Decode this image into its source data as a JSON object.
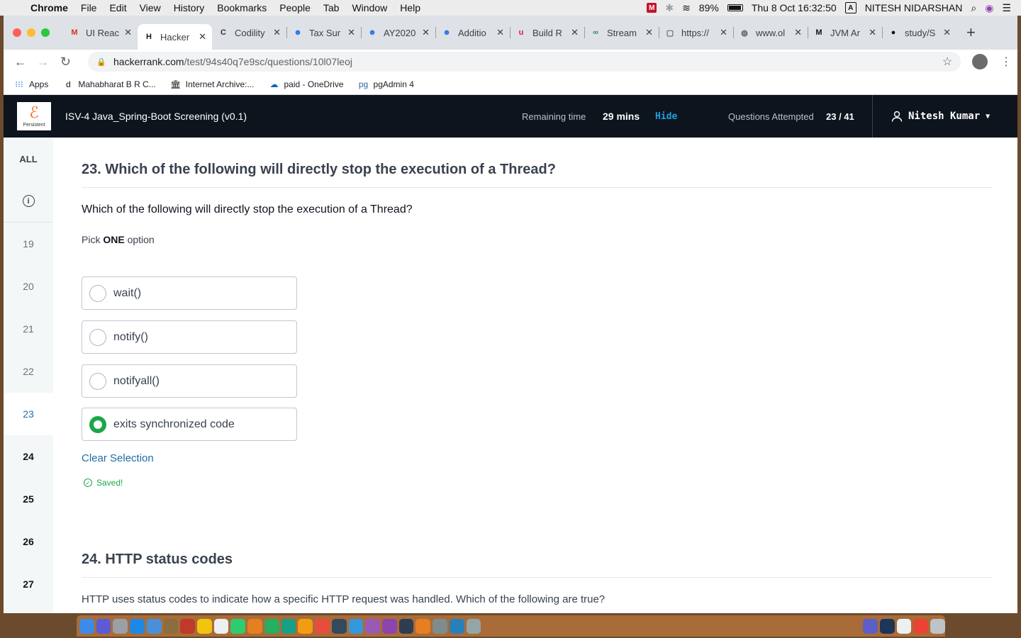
{
  "menubar": {
    "app": "Chrome",
    "items": [
      "File",
      "Edit",
      "View",
      "History",
      "Bookmarks",
      "People",
      "Tab",
      "Window",
      "Help"
    ],
    "battery": "89%",
    "datetime": "Thu 8 Oct  16:32:50",
    "input_source": "A",
    "user": "NITESH NIDARSHAN"
  },
  "tabs": [
    {
      "title": "UI Reac",
      "icon": "gmail-icon",
      "color": "#d93025",
      "glyph": "M",
      "active": false
    },
    {
      "title": "Hacker",
      "icon": "hackerrank-icon",
      "color": "#0e141e",
      "glyph": "H",
      "active": true
    },
    {
      "title": "Codility",
      "icon": "codility-icon",
      "color": "#333333",
      "glyph": "C",
      "active": false
    },
    {
      "title": "Tax Sur",
      "icon": "person-icon",
      "color": "#1a73e8",
      "glyph": "☻",
      "active": false
    },
    {
      "title": "AY2020",
      "icon": "person-icon",
      "color": "#1a73e8",
      "glyph": "☻",
      "active": false
    },
    {
      "title": "Additio",
      "icon": "person-icon",
      "color": "#1a73e8",
      "glyph": "☻",
      "active": false
    },
    {
      "title": "Build R",
      "icon": "build-icon",
      "color": "#e11d48",
      "glyph": "u",
      "active": false
    },
    {
      "title": "Stream",
      "icon": "stream-icon",
      "color": "#2e8b57",
      "glyph": "∞",
      "active": false
    },
    {
      "title": "https://",
      "icon": "page-icon",
      "color": "#5f6368",
      "glyph": "▢",
      "active": false
    },
    {
      "title": "www.ol",
      "icon": "globe-icon",
      "color": "#5f6368",
      "glyph": "◍",
      "active": false
    },
    {
      "title": "JVM Ar",
      "icon": "medium-icon",
      "color": "#111111",
      "glyph": "M",
      "active": false
    },
    {
      "title": "study/S",
      "icon": "github-icon",
      "color": "#111111",
      "glyph": "●",
      "active": false
    }
  ],
  "address": {
    "host": "hackerrank.com",
    "path": "/test/94s40q7e9sc/questions/10l07leoj"
  },
  "bookmarks": [
    {
      "label": "Apps",
      "icon": "apps-grid-icon",
      "glyph": "⁝⁝⁝",
      "color": "#1a73e8"
    },
    {
      "label": "Mahabharat B R C...",
      "icon": "d-logo-icon",
      "glyph": "d",
      "color": "#111111"
    },
    {
      "label": "Internet Archive:...",
      "icon": "archive-icon",
      "glyph": "🏛",
      "color": "#111111"
    },
    {
      "label": "paid - OneDrive",
      "icon": "onedrive-icon",
      "glyph": "☁",
      "color": "#0a66c2"
    },
    {
      "label": "pgAdmin 4",
      "icon": "pgadmin-icon",
      "glyph": "pg",
      "color": "#336791"
    }
  ],
  "header": {
    "test_name": "ISV-4 Java_Spring-Boot Screening (v0.1)",
    "logo_text": "Persistent",
    "remaining_label": "Remaining time",
    "remaining_value": "29 mins",
    "hide_label": "Hide",
    "attempted_label": "Questions Attempted",
    "attempted_value": "23 / 41",
    "user_name": "Nitesh Kumar"
  },
  "sidenav": {
    "all_label": "ALL",
    "questions": [
      {
        "num": "19",
        "state": "done"
      },
      {
        "num": "20",
        "state": "done"
      },
      {
        "num": "21",
        "state": "done"
      },
      {
        "num": "22",
        "state": "done"
      },
      {
        "num": "23",
        "state": "current"
      },
      {
        "num": "24",
        "state": "todo"
      },
      {
        "num": "25",
        "state": "todo"
      },
      {
        "num": "26",
        "state": "todo"
      },
      {
        "num": "27",
        "state": "todo"
      }
    ]
  },
  "question": {
    "title": "23. Which of the following will directly stop the execution of a Thread?",
    "text": "Which of the following will directly stop the execution of a Thread?",
    "pick_prefix": "Pick ",
    "pick_bold": "ONE",
    "pick_suffix": " option",
    "options": [
      {
        "label": "wait()",
        "selected": false
      },
      {
        "label": "notify()",
        "selected": false
      },
      {
        "label": "notifyall()",
        "selected": false
      },
      {
        "label": "exits synchronized code",
        "selected": true
      }
    ],
    "clear_label": "Clear Selection",
    "saved_label": "Saved!"
  },
  "next_question": {
    "title": "24. HTTP status codes",
    "text": "HTTP uses status codes to indicate how a specific HTTP request was handled. Which of the following are true?"
  },
  "colors": {
    "header_bg": "#0e141e",
    "accent_green": "#1aa748",
    "link_blue": "#1f6ea4",
    "hide_blue": "#1ba1e2",
    "logo_orange": "#f26b1d"
  }
}
